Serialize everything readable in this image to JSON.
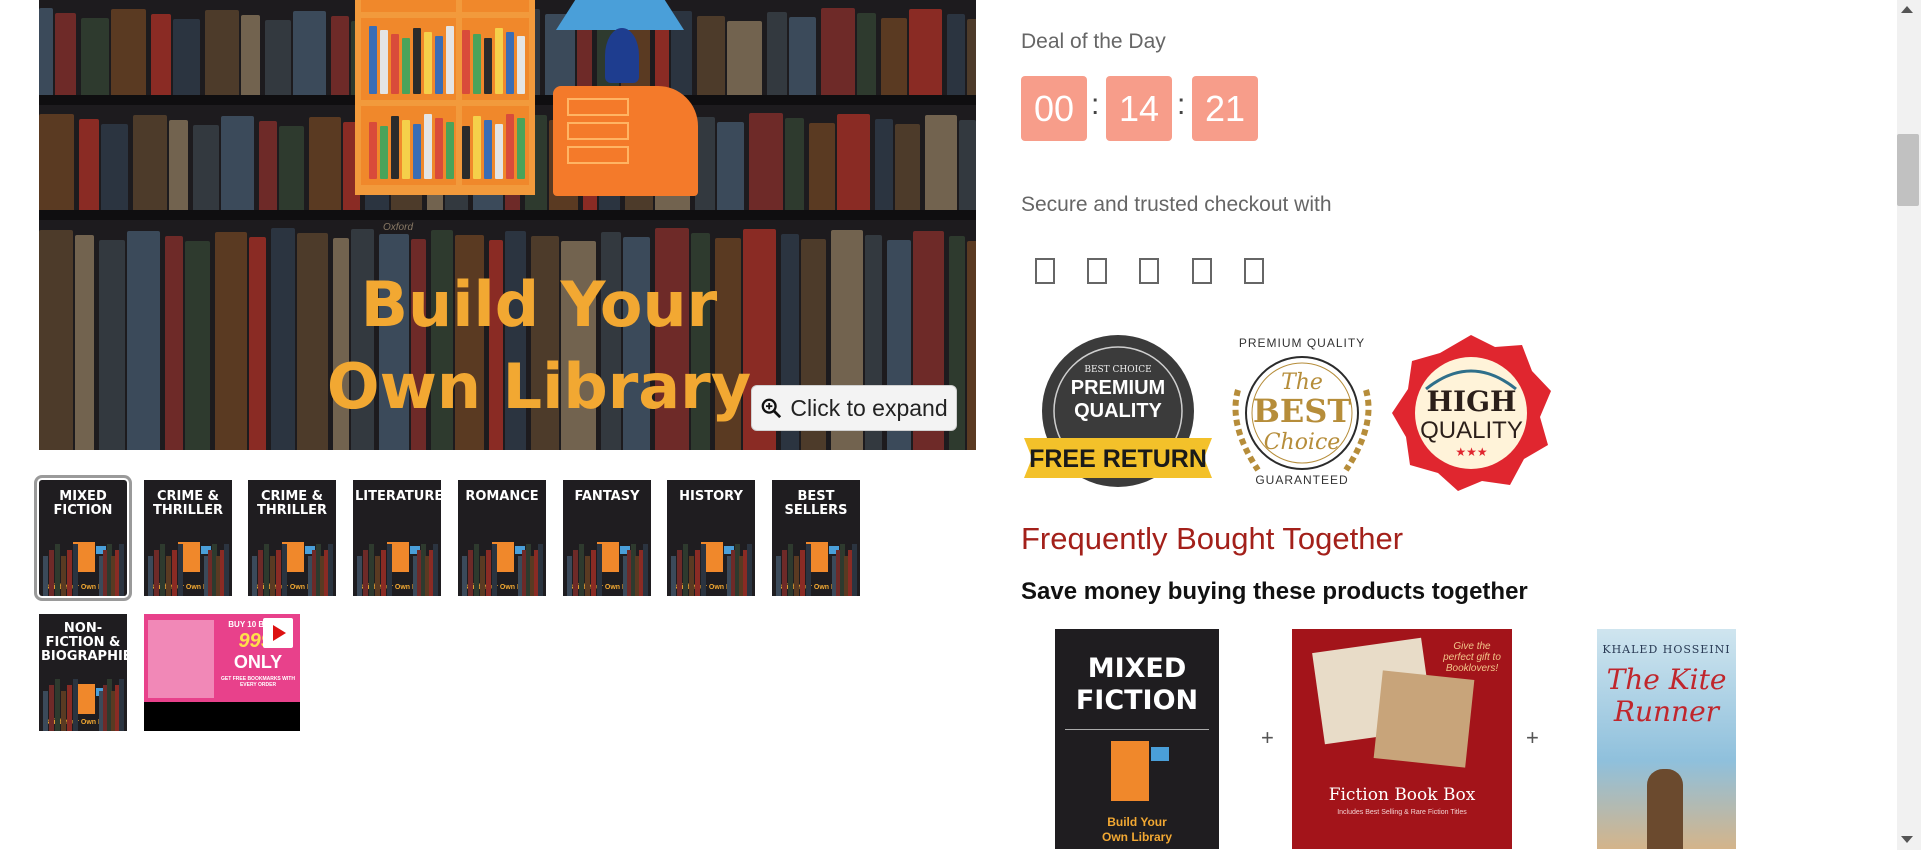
{
  "gallery": {
    "hero_title_line1": "Build Your",
    "hero_title_line2": "Own Library",
    "hero_small_text": "Oxford",
    "expand_label": "Click to expand",
    "thumbnails": [
      {
        "label": "MIXED FICTION"
      },
      {
        "label": "CRIME & THRILLER"
      },
      {
        "label": "CRIME & THRILLER"
      },
      {
        "label": "LITERATURE"
      },
      {
        "label": "ROMANCE"
      },
      {
        "label": "FANTASY"
      },
      {
        "label": "HISTORY"
      },
      {
        "label": "BEST SELLERS"
      },
      {
        "label": "NON-FICTION & BIOGRAPHIES"
      }
    ],
    "thumb_footer": "Build Your Own Library",
    "video_thumb": {
      "headline": "BUY 10 BOOKS",
      "price": "999/",
      "only": "ONLY",
      "footer": "GET FREE BOOKMARKS WITH EVERY ORDER"
    }
  },
  "deal": {
    "label": "Deal of the Day",
    "hours": "00",
    "minutes": "14",
    "seconds": "21",
    "box_color": "#f79d8a"
  },
  "checkout": {
    "label": "Secure and trusted checkout with",
    "payment_icons": [
      "payment-icon",
      "payment-icon",
      "payment-icon",
      "payment-icon",
      "payment-icon"
    ]
  },
  "badges": {
    "premium": {
      "top": "BEST CHOICE",
      "mid1": "PREMIUM",
      "mid2": "QUALITY",
      "ribbon": "FREE RETURN"
    },
    "best": {
      "arc_top": "PREMIUM QUALITY",
      "the": "The",
      "best": "BEST",
      "choice": "Choice",
      "arc_bottom": "GUARANTEED"
    },
    "high": {
      "line1": "HIGH",
      "line2": "QUALITY",
      "stars": "★★★"
    }
  },
  "frequently_bought": {
    "title": "Frequently Bought Together",
    "subtitle": "Save money buying these products together",
    "plus": "+",
    "products": [
      {
        "line1": "MIXED",
        "line2": "FICTION",
        "footer1": "Build Your",
        "footer2": "Own Library"
      },
      {
        "title": "Fiction Book Box",
        "tagline": "Includes Best Selling & Rare Fiction Titles",
        "script": "Give the perfect gift to Booklovers!"
      },
      {
        "author": "KHALED HOSSEINI",
        "title1": "The Kite",
        "title2": "Runner"
      }
    ]
  },
  "colors": {
    "accent_red": "#a3201a",
    "gold": "#f2a832",
    "timer": "#f79d8a"
  }
}
